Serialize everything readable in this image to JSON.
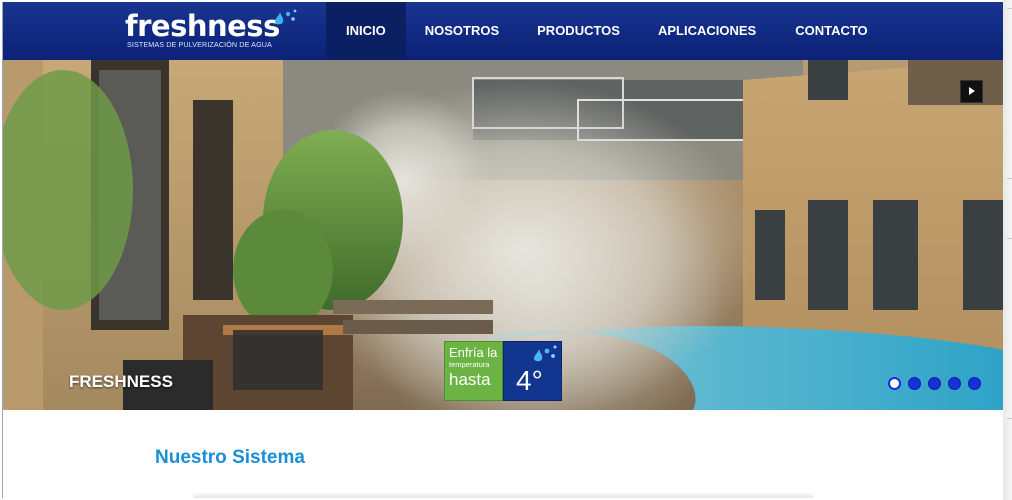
{
  "brand": {
    "name": "freshness",
    "tagline": "SISTEMAS DE PULVERIZACIÓN DE AGUA",
    "colors": {
      "header": "#102a82",
      "accent": "#1a8fd6",
      "nav_active": "#0b1f63"
    }
  },
  "nav": {
    "items": [
      {
        "label": "INICIO",
        "active": true
      },
      {
        "label": "NOSOTROS",
        "active": false
      },
      {
        "label": "PRODUCTOS",
        "active": false
      },
      {
        "label": "APLICACIONES",
        "active": false
      },
      {
        "label": "CONTACTO",
        "active": false
      }
    ]
  },
  "slider": {
    "caption": "FRESHNESS",
    "next_icon": "play-arrow-icon",
    "badge": {
      "line1": "Enfría la",
      "line2": "temperatura",
      "line3": "hasta",
      "value": "4°",
      "left_color": "#6bb343",
      "right_color": "#12358f"
    },
    "pagination": {
      "total": 5,
      "active_index": 0
    }
  },
  "main": {
    "section_title": "Nuestro Sistema"
  }
}
